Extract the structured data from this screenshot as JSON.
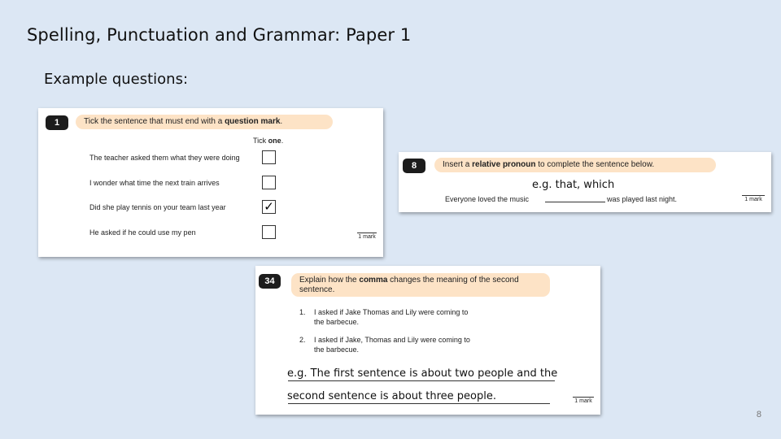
{
  "slide": {
    "title": "Spelling, Punctuation and Grammar: Paper 1",
    "subtitle": "Example questions:",
    "page_number": "8"
  },
  "q1": {
    "number": "1",
    "prompt_pre": "Tick the sentence that must end with a ",
    "prompt_bold": "question mark",
    "prompt_post": ".",
    "tick_header_pre": "Tick ",
    "tick_header_bold": "one",
    "tick_header_post": ".",
    "options": [
      {
        "text": "The teacher asked them what they were doing",
        "ticked": ""
      },
      {
        "text": "I wonder what time the next train arrives",
        "ticked": ""
      },
      {
        "text": "Did she play tennis on your team last year",
        "ticked": "✓"
      },
      {
        "text": "He asked if he could use my pen",
        "ticked": ""
      }
    ],
    "mark": "1 mark"
  },
  "q8": {
    "number": "8",
    "prompt_pre": "Insert a ",
    "prompt_bold": "relative pronoun",
    "prompt_post": " to complete the sentence below.",
    "answer_note": "e.g. that, which",
    "sentence_start": "Everyone loved the music",
    "sentence_end": "was played last night.",
    "mark": "1 mark"
  },
  "q34": {
    "number": "34",
    "prompt_pre": "Explain how the ",
    "prompt_bold": "comma",
    "prompt_post": " changes the meaning of the second sentence.",
    "items": [
      {
        "num": "1.",
        "line1": "I asked if Jake Thomas and Lily were coming to",
        "line2": "the barbecue."
      },
      {
        "num": "2.",
        "line1": "I asked if Jake, Thomas and Lily were coming to",
        "line2": "the barbecue."
      }
    ],
    "answer_line1": "e.g. The first sentence is about two people and the",
    "answer_line2": "second sentence is about three people.",
    "mark": "1 mark"
  }
}
